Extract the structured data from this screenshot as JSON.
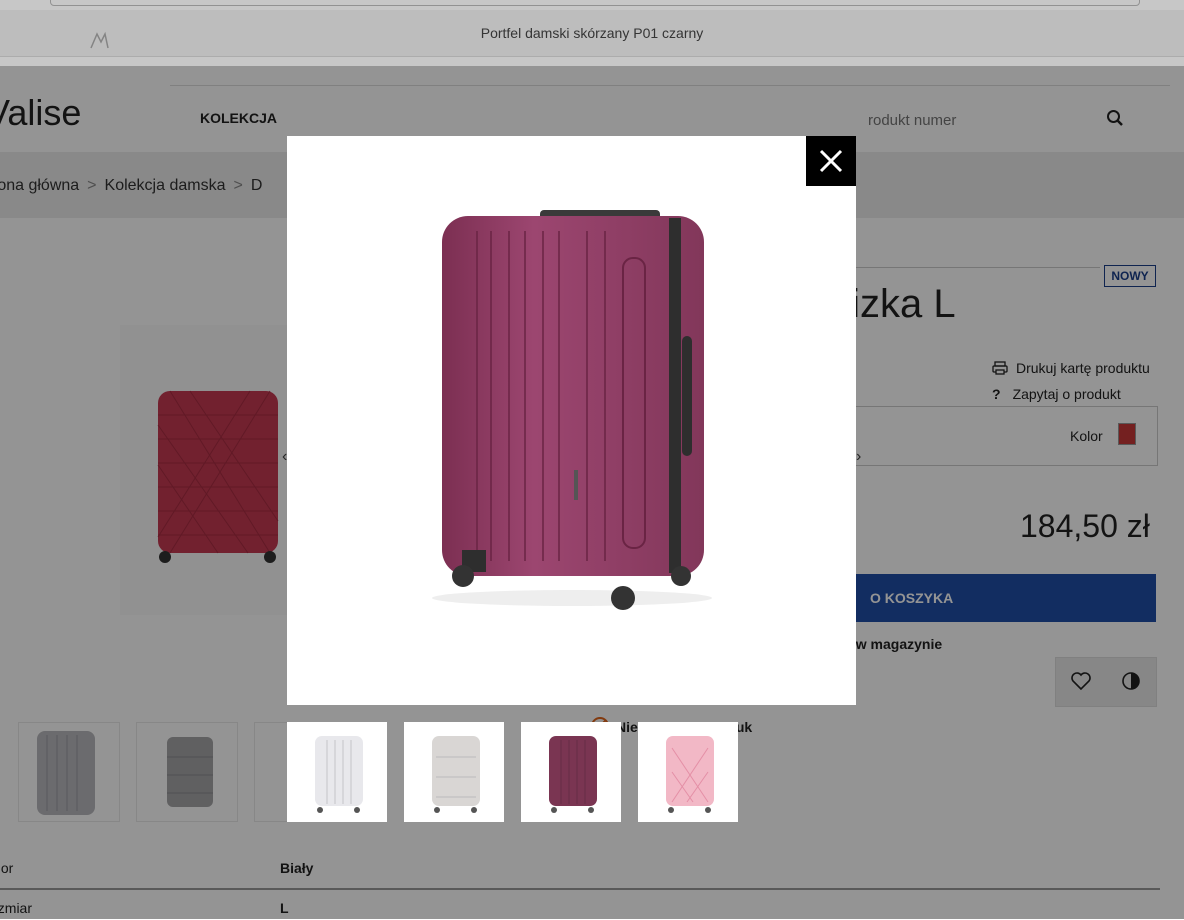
{
  "browser": {
    "notice_text": "Portfel damski skórzany P01 czarny"
  },
  "header": {
    "logo_text": "Valise",
    "nav_kolekcja": "KOLEKCJA",
    "search_placeholder": "rodukt numer"
  },
  "breadcrumb": {
    "items": [
      "rona główna",
      "Kolekcja damska",
      "D"
    ]
  },
  "product": {
    "badge": "NOWY",
    "title_visible": "alizka L",
    "print_label": "Drukuj kartę produktu",
    "ask_label": "Zapytaj o produkt",
    "color_label": "Kolor",
    "color_value": "#c83737",
    "price": "184,50 zł",
    "add_to_cart": "O KOSZYKA",
    "stock_text": "któw w magazynie",
    "notify_text": "Nie     cej ilości produk"
  },
  "specs": [
    {
      "key": "olor",
      "value": "Biały"
    },
    {
      "key": "ozmiar",
      "value": "L"
    }
  ],
  "lightbox": {
    "main_image_color": "#8e3a5e",
    "thumbnails": [
      {
        "color": "#e8e8ec",
        "name": "white"
      },
      {
        "color": "#d9d6d4",
        "name": "grey"
      },
      {
        "color": "#7a3552",
        "name": "burgundy"
      },
      {
        "color": "#f2b8c6",
        "name": "pink"
      }
    ]
  },
  "colors": {
    "accent": "#1f4ea8",
    "overlay": "#000000"
  }
}
